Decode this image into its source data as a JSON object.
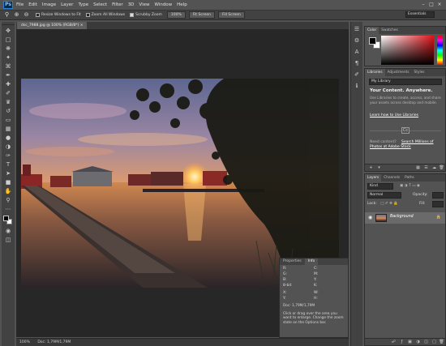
{
  "app": {
    "logo": "Ps"
  },
  "menu": [
    "File",
    "Edit",
    "Image",
    "Layer",
    "Type",
    "Select",
    "Filter",
    "3D",
    "View",
    "Window",
    "Help"
  ],
  "window_controls": [
    "–",
    "□",
    "×"
  ],
  "options_bar": {
    "resize_windows": "Resize Windows to Fit",
    "zoom_all": "Zoom All Windows",
    "scrubby_zoom": "Scrubby Zoom",
    "btn_100": "100%",
    "btn_fit": "Fit Screen",
    "btn_fill": "Fill Screen",
    "workspace": "Essentials"
  },
  "document": {
    "tab_title": "dsc_7988.jpg @ 100% (RGB/8*) ×",
    "status": "100%",
    "doc_size": "Doc: 1,79M/1,79M"
  },
  "info_panel": {
    "tabs": [
      "Properties",
      "Info"
    ],
    "rows": [
      {
        "a": "R:",
        "b": "C:"
      },
      {
        "a": "G:",
        "b": "M:"
      },
      {
        "a": "B:",
        "b": "Y:"
      },
      {
        "a": "8-bit",
        "b": "K:"
      },
      {
        "a": "X:",
        "b": "W:"
      },
      {
        "a": "Y:",
        "b": "H:"
      }
    ],
    "doc": "Doc: 1,79M/1,79M",
    "hint": "Click or drag over the area you want to enlarge. Change the zoom state on the Options bar."
  },
  "color_panel": {
    "tabs": [
      "Color",
      "Swatches"
    ]
  },
  "libraries_panel": {
    "tabs": [
      "Libraries",
      "Adjustments",
      "Styles"
    ],
    "library_select": "My Library",
    "heading": "Your Content. Anywhere.",
    "description": "Use Libraries to create, access, and share your assets across desktop and mobile.",
    "learn_link": "Learn how to Use Libraries",
    "cc_icon": "Cc",
    "stock_question": "Need content?",
    "stock_link": "Search Millions of",
    "stock_link2": "Photos at Adobe Stock"
  },
  "layers_panel": {
    "tabs": [
      "Layers",
      "Channels",
      "Paths"
    ],
    "kind_filter": "Kind",
    "blend_mode": "Normal",
    "opacity_label": "Opacity:",
    "lock_label": "Lock:",
    "fill_label": "Fill:",
    "layer_name": "Background"
  }
}
